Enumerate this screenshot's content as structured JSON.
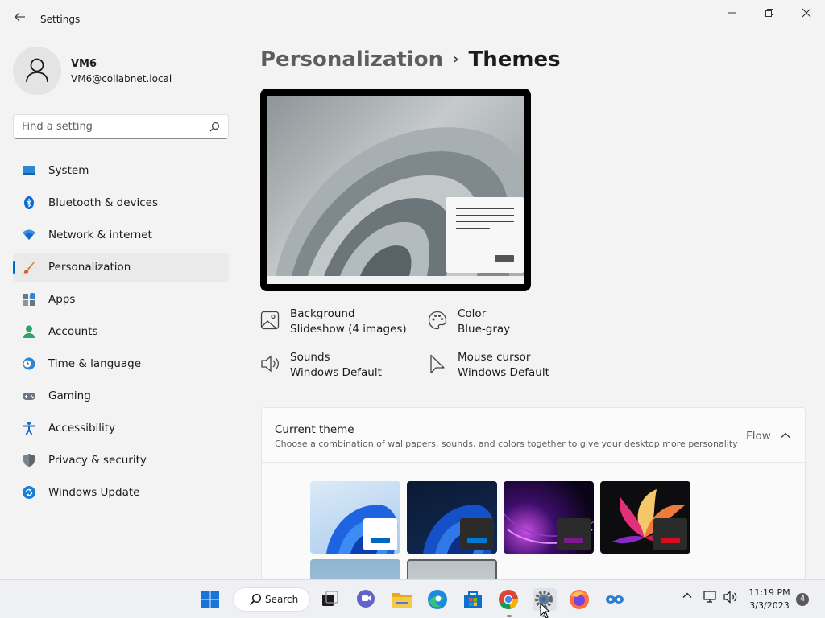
{
  "window": {
    "title": "Settings"
  },
  "profile": {
    "name": "VM6",
    "email": "VM6@collabnet.local"
  },
  "search": {
    "placeholder": "Find a setting"
  },
  "nav": [
    {
      "label": "System",
      "icon": "system-icon",
      "active": false
    },
    {
      "label": "Bluetooth & devices",
      "icon": "bluetooth-icon",
      "active": false
    },
    {
      "label": "Network & internet",
      "icon": "network-icon",
      "active": false
    },
    {
      "label": "Personalization",
      "icon": "brush-icon",
      "active": true
    },
    {
      "label": "Apps",
      "icon": "apps-icon",
      "active": false
    },
    {
      "label": "Accounts",
      "icon": "accounts-icon",
      "active": false
    },
    {
      "label": "Time & language",
      "icon": "clock-globe-icon",
      "active": false
    },
    {
      "label": "Gaming",
      "icon": "gamepad-icon",
      "active": false
    },
    {
      "label": "Accessibility",
      "icon": "accessibility-icon",
      "active": false
    },
    {
      "label": "Privacy & security",
      "icon": "shield-icon",
      "active": false
    },
    {
      "label": "Windows Update",
      "icon": "update-icon",
      "active": false
    }
  ],
  "breadcrumb": {
    "parent": "Personalization",
    "separator": "›",
    "current": "Themes"
  },
  "properties": {
    "background": {
      "title": "Background",
      "value": "Slideshow (4 images)"
    },
    "color": {
      "title": "Color",
      "value": "Blue-gray"
    },
    "sounds": {
      "title": "Sounds",
      "value": "Windows Default"
    },
    "cursor": {
      "title": "Mouse cursor",
      "value": "Windows Default"
    }
  },
  "current_theme": {
    "title": "Current theme",
    "subtitle": "Choose a combination of wallpapers, sounds, and colors together to give your desktop more personality",
    "value": "Flow"
  },
  "themes": [
    {
      "name": "windows-light",
      "accent": "#0067c0"
    },
    {
      "name": "windows-dark",
      "accent": "#0078d4"
    },
    {
      "name": "glow",
      "accent": "#7a1a8c"
    },
    {
      "name": "captured-motion",
      "accent": "#d30f1f"
    },
    {
      "name": "sunrise",
      "accent": "#7ea6c2"
    },
    {
      "name": "flow",
      "accent": "#9aa3a8"
    }
  ],
  "taskbar": {
    "search_label": "Search",
    "time": "11:19 PM",
    "date": "3/3/2023",
    "notifications": "4"
  },
  "colors": {
    "accent": "#0067c0",
    "background": "#f3f3f3"
  }
}
